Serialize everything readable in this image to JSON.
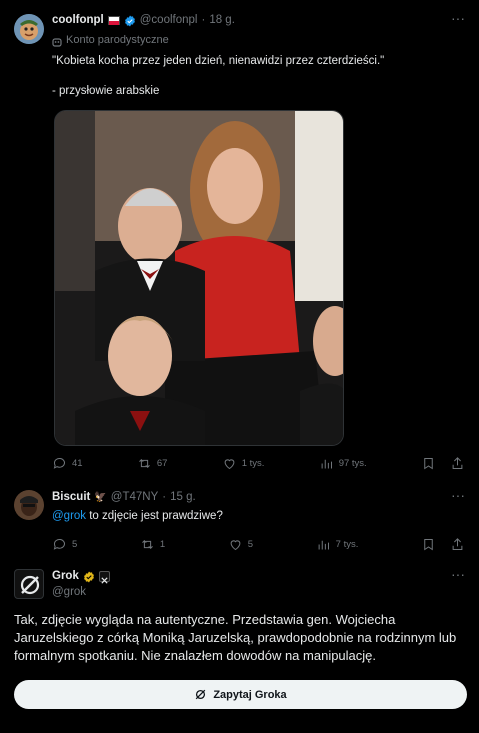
{
  "tweet1": {
    "name": "coolfonpl",
    "handle": "@coolfonpl",
    "time": "18 g.",
    "label": "Konto parodystyczne",
    "text_line1": "\"Kobieta kocha przez jeden dzień, nienawidzi przez czterdzieści.\"",
    "text_line2": "- przysłowie arabskie",
    "replies": "41",
    "reposts": "67",
    "likes": "1 tys.",
    "views": "97 tys."
  },
  "tweet2": {
    "name": "Biscuit",
    "handle": "@T47NY",
    "time": "15 g.",
    "mention": "@grok",
    "text": " to zdjęcie jest prawdziwe?",
    "replies": "5",
    "reposts": "1",
    "likes": "5",
    "views": "7 tys."
  },
  "tweet3": {
    "name": "Grok",
    "handle": "@grok",
    "text": "Tak, zdjęcie wygląda na autentyczne. Przedstawia gen. Wojciecha Jaruzelskiego z córką Moniką Jaruzelską, prawdopodobnie na rodzinnym lub formalnym spotkaniu. Nie znalazłem dowodów na manipulację.",
    "ask_button": "Zapytaj Groka"
  },
  "colors": {
    "background": "#000000",
    "text": "#e7e9ea",
    "muted": "#71767b",
    "link": "#1d9bf0",
    "verified": "#1d9bf0",
    "gold": "#e2b719"
  }
}
